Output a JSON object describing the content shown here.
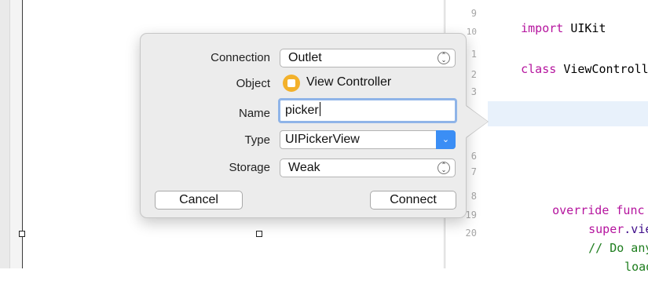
{
  "popover": {
    "rows": {
      "connection": {
        "label": "Connection",
        "value": "Outlet"
      },
      "object": {
        "label": "Object",
        "value": "View Controller"
      },
      "name": {
        "label": "Name",
        "value": "picker"
      },
      "type": {
        "label": "Type",
        "value": "UIPickerView"
      },
      "storage": {
        "label": "Storage",
        "value": "Weak"
      }
    },
    "cancel_label": "Cancel",
    "connect_label": "Connect",
    "accent_color": "#3b8ef5",
    "object_icon_color": "#f3b12b"
  },
  "editor": {
    "line_numbers": [
      "9",
      "10",
      "1",
      "2",
      "3",
      "",
      "",
      "6",
      "7",
      "8",
      "19",
      "20"
    ],
    "lines": {
      "import_kw": "import",
      "import_name": "UIKit",
      "class_kw": "class",
      "class_name": "ViewControll",
      "override_kw": "override func",
      "super_kw": "super",
      "super_rest": ".view",
      "comment_1": "// Do any",
      "comment_2": "loadin"
    }
  }
}
